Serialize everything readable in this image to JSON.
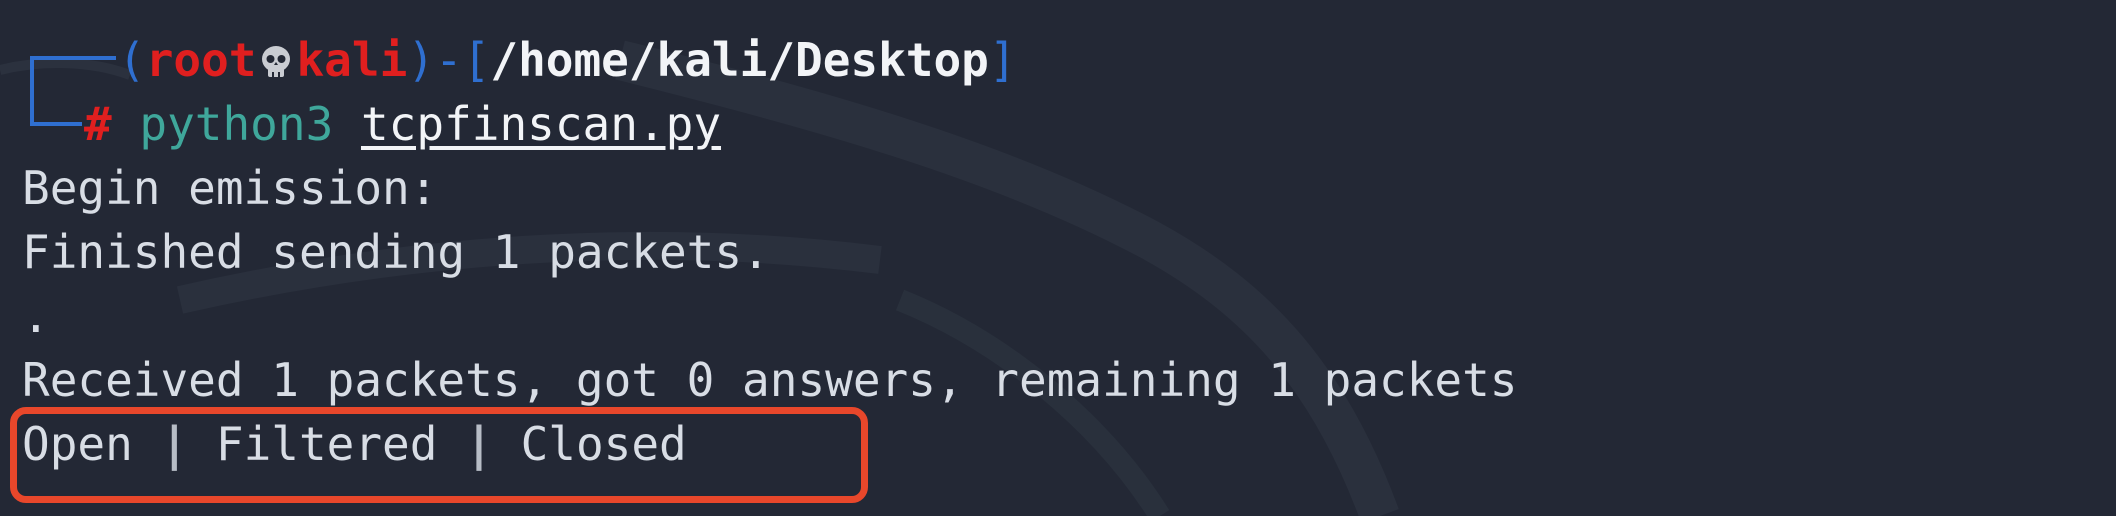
{
  "prompt": {
    "open_paren": "(",
    "user": "root",
    "host": "kali",
    "close_paren": ")",
    "dash": "-",
    "open_bracket": "[",
    "path": "/home/kali/Desktop",
    "close_bracket": "]",
    "hash": "#",
    "command": "python3",
    "argument": "tcpfinscan.py"
  },
  "output": {
    "line1": "Begin emission:",
    "line2": "Finished sending 1 packets.",
    "line3": ".",
    "line4": "Received 1 packets, got 0 answers, remaining 1 packets"
  },
  "result": {
    "open": "Open",
    "separator": "|",
    "filtered": "Filtered",
    "closed": "Closed"
  },
  "colors": {
    "background": "#232835",
    "prompt_blue": "#2f6fd0",
    "user_red": "#e01f1f",
    "command_green": "#3fa79b",
    "highlight_border": "#e8472b"
  },
  "icons": {
    "skull": "skull-icon"
  }
}
